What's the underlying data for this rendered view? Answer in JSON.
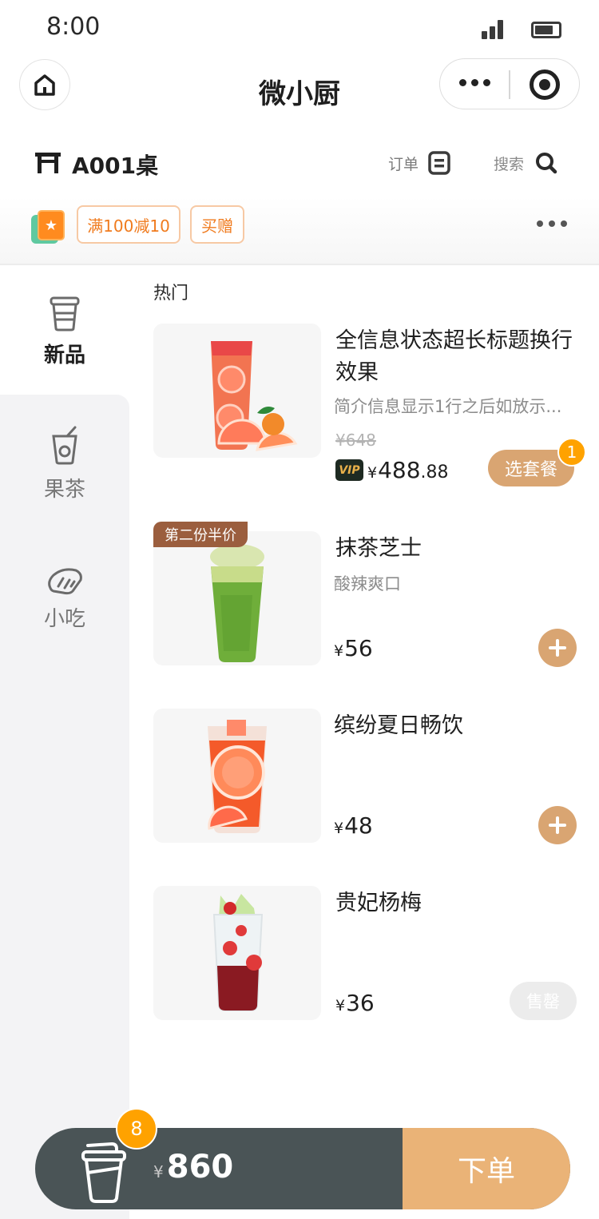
{
  "status_bar": {
    "time": "8:00"
  },
  "nav": {
    "title": "微小厨"
  },
  "table": {
    "label": "A001桌",
    "order_label": "订单",
    "search_label": "搜索"
  },
  "promotions": {
    "tags": [
      "满100减10",
      "买赠"
    ]
  },
  "sidebar": {
    "items": [
      {
        "label": "新品",
        "icon": "cup-icon",
        "active": true
      },
      {
        "label": "果茶",
        "icon": "fruit-tea-icon",
        "active": false
      },
      {
        "label": "小吃",
        "icon": "bread-icon",
        "active": false
      }
    ]
  },
  "section": {
    "title": "热门"
  },
  "products": [
    {
      "name": "全信息状态超长标题换行效果",
      "desc": "简介信息显示1行之后如放示...",
      "original_price": "¥648",
      "currency": "¥",
      "price_int": "488",
      "price_dec": ".88",
      "vip_label": "VIP",
      "action": "选套餐",
      "badge": "1"
    },
    {
      "name": "抹茶芝士",
      "desc": "酸辣爽口",
      "tag": "第二份半价",
      "currency": "¥",
      "price_int": "56",
      "action": "add"
    },
    {
      "name": "缤纷夏日畅饮",
      "currency": "¥",
      "price_int": "48",
      "action": "add"
    },
    {
      "name": "贵妃杨梅",
      "currency": "¥",
      "price_int": "36",
      "action": "售罄"
    }
  ],
  "cart": {
    "count": "8",
    "currency": "¥",
    "total": "860",
    "submit_label": "下单"
  },
  "colors": {
    "accent": "#d9a572",
    "badge": "#ffa200",
    "cart_bg": "#4a5456",
    "submit_bg": "#eab377",
    "promo_text": "#f07b1e"
  }
}
